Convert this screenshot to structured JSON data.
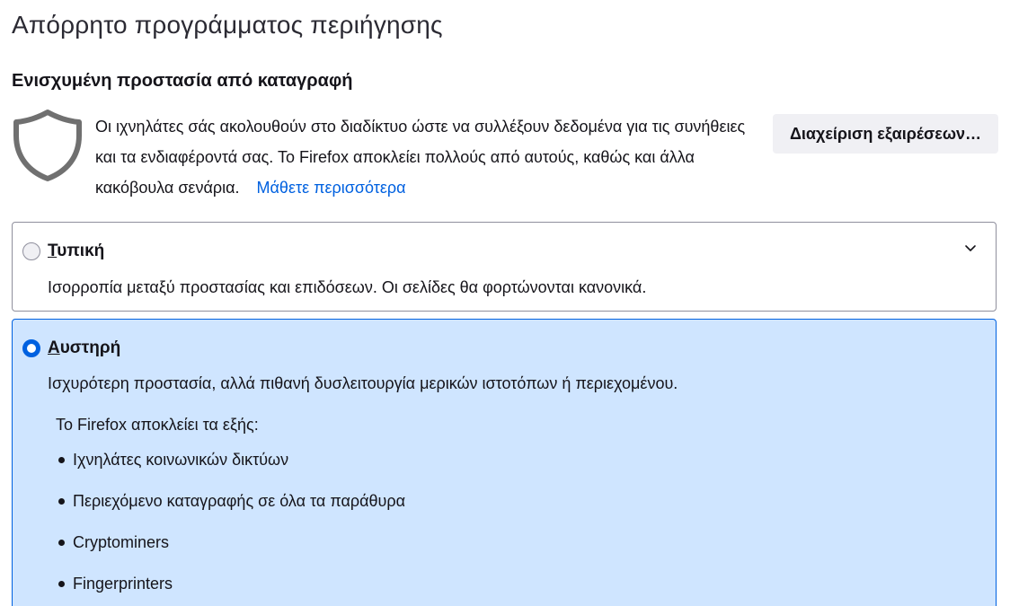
{
  "header": {
    "title": "Απόρρητο προγράμματος περιήγησης"
  },
  "etp": {
    "section_title": "Ενισχυμένη προστασία από καταγραφή",
    "shield_icon": "shield-icon",
    "description": "Οι ιχνηλάτες σάς ακολουθούν στο διαδίκτυο ώστε να συλλέξουν δεδομένα για τις συνήθειες και τα ενδιαφέροντά σας. Το Firefox αποκλείει πολλούς από αυτούς, καθώς και άλλα κακόβουλα σενάρια.",
    "learn_more": "Μάθετε περισσότερα",
    "manage_exceptions": "Διαχείριση εξαιρέσεων…"
  },
  "options": {
    "standard": {
      "label_first": "Τ",
      "label_rest": "υπική",
      "description": "Ισορροπία μεταξύ προστασίας και επιδόσεων. Οι σελίδες θα φορτώνονται κανονικά.",
      "selected": false,
      "expand_icon": "chevron-down-icon"
    },
    "strict": {
      "label_first": "Α",
      "label_rest": "υστηρή",
      "description": "Ισχυρότερη προστασία, αλλά πιθανή δυσλειτουργία μερικών ιστοτόπων ή περιεχομένου.",
      "selected": true,
      "blocks_intro": "Το Firefox αποκλείει τα εξής:",
      "blocks": [
        "Ιχνηλάτες κοινωνικών δικτύων",
        "Περιεχόμενο καταγραφής σε όλα τα παράθυρα",
        "Cryptominers",
        "Fingerprinters"
      ]
    }
  },
  "colors": {
    "accent": "#0061e0",
    "selected_card_bg": "#cfe5ff",
    "button_bg": "#f0f0f4",
    "text": "#15141a"
  }
}
